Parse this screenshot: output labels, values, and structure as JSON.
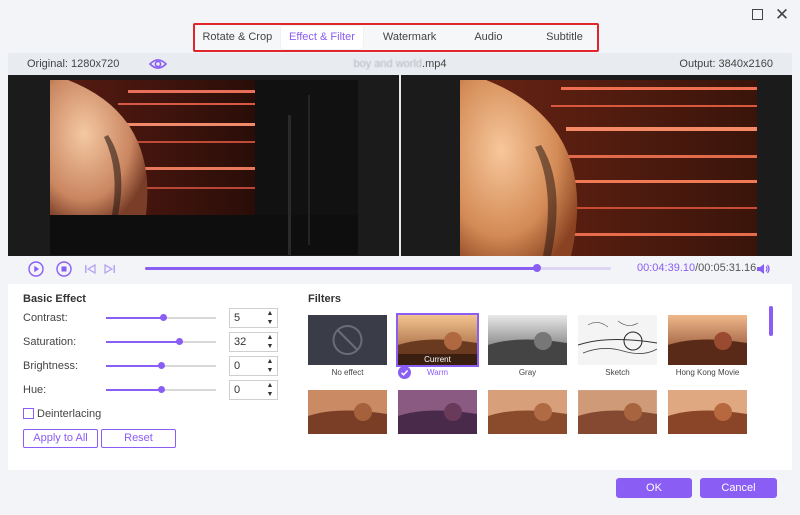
{
  "tabs": [
    {
      "label": "Rotate & Crop",
      "active": false
    },
    {
      "label": "Effect & Filter",
      "active": true
    },
    {
      "label": "Watermark",
      "active": false
    },
    {
      "label": "Audio",
      "active": false
    },
    {
      "label": "Subtitle",
      "active": false
    }
  ],
  "info": {
    "original": "Original: 1280x720",
    "file_blurred": "boy and world",
    "file_ext": ".mp4",
    "output": "Output: 3840x2160"
  },
  "player": {
    "current_time": "00:04:39.10",
    "total_time": "/00:05:31.16",
    "progress": 0.842
  },
  "basic_effect": {
    "title": "Basic Effect",
    "items": [
      {
        "label": "Contrast:",
        "value": "5",
        "level": 0.52
      },
      {
        "label": "Saturation:",
        "value": "32",
        "level": 0.66
      },
      {
        "label": "Brightness:",
        "value": "0",
        "level": 0.5
      },
      {
        "label": "Hue:",
        "value": "0",
        "level": 0.5
      }
    ],
    "deinterlacing": "Deinterlacing",
    "apply_all": "Apply to All",
    "reset": "Reset"
  },
  "filters": {
    "title": "Filters",
    "current_label": "Current",
    "items": [
      {
        "name": "No effect"
      },
      {
        "name": "Warm",
        "selected": true
      },
      {
        "name": "Gray"
      },
      {
        "name": "Sketch"
      },
      {
        "name": "Hong Kong Movie"
      }
    ]
  },
  "footer": {
    "ok": "OK",
    "cancel": "Cancel"
  },
  "colors": {
    "accent": "#8a5df5",
    "tab_highlight": "#e0252c"
  }
}
